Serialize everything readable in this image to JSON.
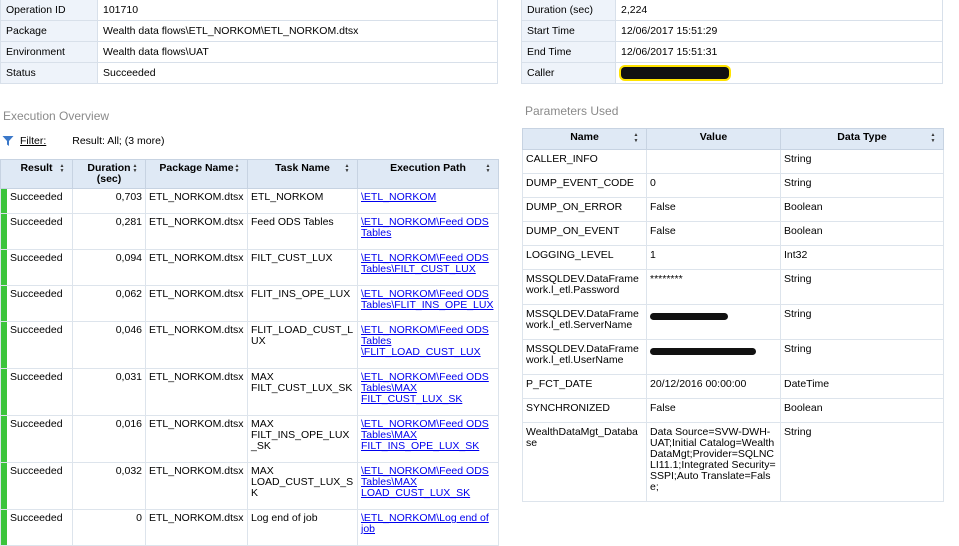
{
  "summary_left": [
    {
      "key": "Operation ID",
      "value": "101710"
    },
    {
      "key": "Package",
      "value": "Wealth data flows\\ETL_NORKOM\\ETL_NORKOM.dtsx"
    },
    {
      "key": "Environment",
      "value": "Wealth data flows\\UAT"
    },
    {
      "key": "Status",
      "value": "Succeeded"
    }
  ],
  "summary_right": [
    {
      "key": "Duration (sec)",
      "value": "2,224"
    },
    {
      "key": "Start Time",
      "value": "12/06/2017 15:51:29"
    },
    {
      "key": "End Time",
      "value": "12/06/2017 15:51:31"
    },
    {
      "key": "Caller",
      "value": ""
    }
  ],
  "execution_overview": {
    "title": "Execution Overview",
    "filter_label": "Filter:",
    "filter_value": "Result: All;  (3 more)",
    "columns": [
      "Result",
      "Duration (sec)",
      "Package Name",
      "Task Name",
      "Execution Path"
    ],
    "rows": [
      {
        "result": "Succeeded",
        "duration": "0,703",
        "package": "ETL_NORKOM.dtsx",
        "task": "ETL_NORKOM",
        "path": "\\ETL_NORKOM"
      },
      {
        "result": "Succeeded",
        "duration": "0,281",
        "package": "ETL_NORKOM.dtsx",
        "task": "Feed ODS Tables",
        "path": "\\ETL_NORKOM\\Feed ODS Tables"
      },
      {
        "result": "Succeeded",
        "duration": "0,094",
        "package": "ETL_NORKOM.dtsx",
        "task": "FILT_CUST_LUX",
        "path": "\\ETL_NORKOM\\Feed ODS Tables\\FILT_CUST_LUX"
      },
      {
        "result": "Succeeded",
        "duration": "0,062",
        "package": "ETL_NORKOM.dtsx",
        "task": "FLIT_INS_OPE_LUX",
        "path": "\\ETL_NORKOM\\Feed ODS Tables\\FLIT_INS_OPE_LUX"
      },
      {
        "result": "Succeeded",
        "duration": "0,046",
        "package": "ETL_NORKOM.dtsx",
        "task": "FLIT_LOAD_CUST_LUX",
        "path": "\\ETL_NORKOM\\Feed ODS Tables \\FLIT_LOAD_CUST_LUX"
      },
      {
        "result": "Succeeded",
        "duration": "0,031",
        "package": "ETL_NORKOM.dtsx",
        "task": "MAX FILT_CUST_LUX_SK",
        "path": "\\ETL_NORKOM\\Feed ODS Tables\\MAX FILT_CUST_LUX_SK"
      },
      {
        "result": "Succeeded",
        "duration": "0,016",
        "package": "ETL_NORKOM.dtsx",
        "task": "MAX FILT_INS_OPE_LUX_SK",
        "path": "\\ETL_NORKOM\\Feed ODS Tables\\MAX FILT_INS_OPE_LUX_SK"
      },
      {
        "result": "Succeeded",
        "duration": "0,032",
        "package": "ETL_NORKOM.dtsx",
        "task": "MAX LOAD_CUST_LUX_SK",
        "path": "\\ETL_NORKOM\\Feed ODS Tables\\MAX LOAD_CUST_LUX_SK"
      },
      {
        "result": "Succeeded",
        "duration": "0",
        "package": "ETL_NORKOM.dtsx",
        "task": "Log end of job",
        "path": "\\ETL_NORKOM\\Log end of job"
      }
    ]
  },
  "parameters": {
    "title": "Parameters Used",
    "columns": [
      "Name",
      "Value",
      "Data Type"
    ],
    "rows": [
      {
        "name": "CALLER_INFO",
        "value": "",
        "type": "String"
      },
      {
        "name": "DUMP_EVENT_CODE",
        "value": "0",
        "type": "String"
      },
      {
        "name": "DUMP_ON_ERROR",
        "value": "False",
        "type": "Boolean"
      },
      {
        "name": "DUMP_ON_EVENT",
        "value": "False",
        "type": "Boolean"
      },
      {
        "name": "LOGGING_LEVEL",
        "value": "1",
        "type": "Int32"
      },
      {
        "name": "MSSQLDEV.DataFramework.l_etl.Password",
        "value": "********",
        "type": "String"
      },
      {
        "name": "MSSQLDEV.DataFramework.l_etl.ServerName",
        "value": "",
        "type": "String"
      },
      {
        "name": "MSSQLDEV.DataFramework.l_etl.UserName",
        "value": "",
        "type": "String"
      },
      {
        "name": "P_FCT_DATE",
        "value": "20/12/2016 00:00:00",
        "type": "DateTime"
      },
      {
        "name": "SYNCHRONIZED",
        "value": "False",
        "type": "Boolean"
      },
      {
        "name": "WealthDataMgt_Database",
        "value": "Data Source=SVW-DWH-UAT;Initial Catalog=WealthDataMgt;Provider=SQLNCLI11.1;Integrated Security=SSPI;Auto Translate=False;",
        "type": "String"
      }
    ]
  }
}
